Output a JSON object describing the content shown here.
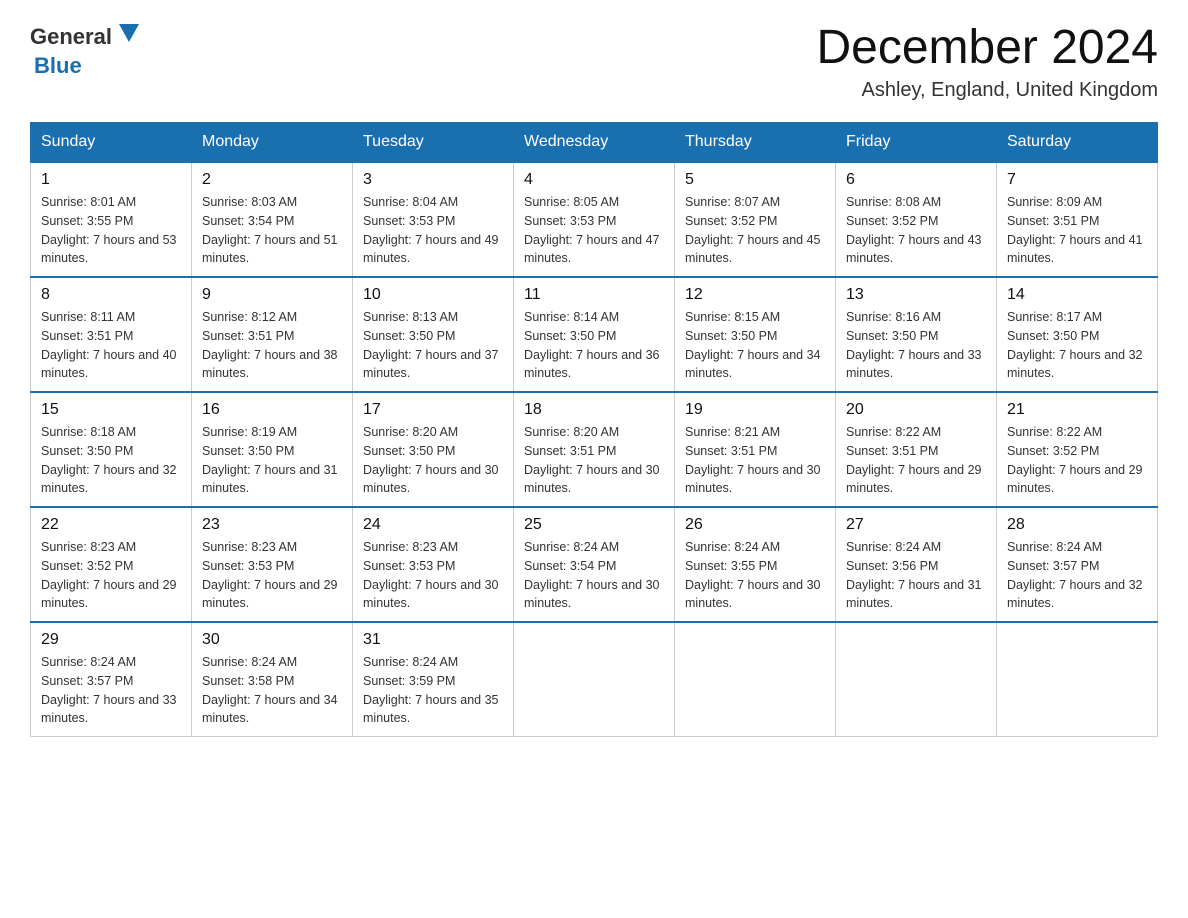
{
  "header": {
    "logo_general": "General",
    "logo_blue": "Blue",
    "month_title": "December 2024",
    "location": "Ashley, England, United Kingdom"
  },
  "days_of_week": [
    "Sunday",
    "Monday",
    "Tuesday",
    "Wednesday",
    "Thursday",
    "Friday",
    "Saturday"
  ],
  "weeks": [
    [
      {
        "day": "1",
        "sunrise": "8:01 AM",
        "sunset": "3:55 PM",
        "daylight": "7 hours and 53 minutes."
      },
      {
        "day": "2",
        "sunrise": "8:03 AM",
        "sunset": "3:54 PM",
        "daylight": "7 hours and 51 minutes."
      },
      {
        "day": "3",
        "sunrise": "8:04 AM",
        "sunset": "3:53 PM",
        "daylight": "7 hours and 49 minutes."
      },
      {
        "day": "4",
        "sunrise": "8:05 AM",
        "sunset": "3:53 PM",
        "daylight": "7 hours and 47 minutes."
      },
      {
        "day": "5",
        "sunrise": "8:07 AM",
        "sunset": "3:52 PM",
        "daylight": "7 hours and 45 minutes."
      },
      {
        "day": "6",
        "sunrise": "8:08 AM",
        "sunset": "3:52 PM",
        "daylight": "7 hours and 43 minutes."
      },
      {
        "day": "7",
        "sunrise": "8:09 AM",
        "sunset": "3:51 PM",
        "daylight": "7 hours and 41 minutes."
      }
    ],
    [
      {
        "day": "8",
        "sunrise": "8:11 AM",
        "sunset": "3:51 PM",
        "daylight": "7 hours and 40 minutes."
      },
      {
        "day": "9",
        "sunrise": "8:12 AM",
        "sunset": "3:51 PM",
        "daylight": "7 hours and 38 minutes."
      },
      {
        "day": "10",
        "sunrise": "8:13 AM",
        "sunset": "3:50 PM",
        "daylight": "7 hours and 37 minutes."
      },
      {
        "day": "11",
        "sunrise": "8:14 AM",
        "sunset": "3:50 PM",
        "daylight": "7 hours and 36 minutes."
      },
      {
        "day": "12",
        "sunrise": "8:15 AM",
        "sunset": "3:50 PM",
        "daylight": "7 hours and 34 minutes."
      },
      {
        "day": "13",
        "sunrise": "8:16 AM",
        "sunset": "3:50 PM",
        "daylight": "7 hours and 33 minutes."
      },
      {
        "day": "14",
        "sunrise": "8:17 AM",
        "sunset": "3:50 PM",
        "daylight": "7 hours and 32 minutes."
      }
    ],
    [
      {
        "day": "15",
        "sunrise": "8:18 AM",
        "sunset": "3:50 PM",
        "daylight": "7 hours and 32 minutes."
      },
      {
        "day": "16",
        "sunrise": "8:19 AM",
        "sunset": "3:50 PM",
        "daylight": "7 hours and 31 minutes."
      },
      {
        "day": "17",
        "sunrise": "8:20 AM",
        "sunset": "3:50 PM",
        "daylight": "7 hours and 30 minutes."
      },
      {
        "day": "18",
        "sunrise": "8:20 AM",
        "sunset": "3:51 PM",
        "daylight": "7 hours and 30 minutes."
      },
      {
        "day": "19",
        "sunrise": "8:21 AM",
        "sunset": "3:51 PM",
        "daylight": "7 hours and 30 minutes."
      },
      {
        "day": "20",
        "sunrise": "8:22 AM",
        "sunset": "3:51 PM",
        "daylight": "7 hours and 29 minutes."
      },
      {
        "day": "21",
        "sunrise": "8:22 AM",
        "sunset": "3:52 PM",
        "daylight": "7 hours and 29 minutes."
      }
    ],
    [
      {
        "day": "22",
        "sunrise": "8:23 AM",
        "sunset": "3:52 PM",
        "daylight": "7 hours and 29 minutes."
      },
      {
        "day": "23",
        "sunrise": "8:23 AM",
        "sunset": "3:53 PM",
        "daylight": "7 hours and 29 minutes."
      },
      {
        "day": "24",
        "sunrise": "8:23 AM",
        "sunset": "3:53 PM",
        "daylight": "7 hours and 30 minutes."
      },
      {
        "day": "25",
        "sunrise": "8:24 AM",
        "sunset": "3:54 PM",
        "daylight": "7 hours and 30 minutes."
      },
      {
        "day": "26",
        "sunrise": "8:24 AM",
        "sunset": "3:55 PM",
        "daylight": "7 hours and 30 minutes."
      },
      {
        "day": "27",
        "sunrise": "8:24 AM",
        "sunset": "3:56 PM",
        "daylight": "7 hours and 31 minutes."
      },
      {
        "day": "28",
        "sunrise": "8:24 AM",
        "sunset": "3:57 PM",
        "daylight": "7 hours and 32 minutes."
      }
    ],
    [
      {
        "day": "29",
        "sunrise": "8:24 AM",
        "sunset": "3:57 PM",
        "daylight": "7 hours and 33 minutes."
      },
      {
        "day": "30",
        "sunrise": "8:24 AM",
        "sunset": "3:58 PM",
        "daylight": "7 hours and 34 minutes."
      },
      {
        "day": "31",
        "sunrise": "8:24 AM",
        "sunset": "3:59 PM",
        "daylight": "7 hours and 35 minutes."
      },
      null,
      null,
      null,
      null
    ]
  ]
}
